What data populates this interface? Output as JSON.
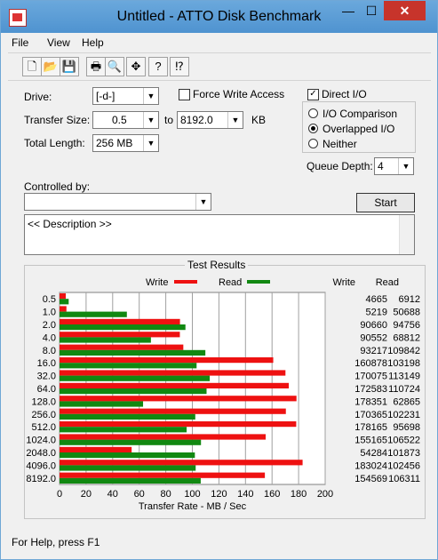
{
  "window": {
    "title": "Untitled - ATTO Disk Benchmark",
    "min": "—",
    "max": "☐",
    "close": "✕"
  },
  "menu": [
    "File",
    "View",
    "Help"
  ],
  "toolbar": [
    "new-icon",
    "open-icon",
    "save-icon",
    "print-icon",
    "print-preview-icon",
    "move-icon",
    "help-icon",
    "context-help-icon"
  ],
  "form": {
    "drive_label": "Drive:",
    "drive_value": "[-d-]",
    "force_write_label": "Force Write Access",
    "force_write_checked": false,
    "direct_io_label": "Direct I/O",
    "direct_io_checked": true,
    "transfer_size_label": "Transfer Size:",
    "transfer_from": "0.5",
    "to_label": "to",
    "transfer_to": "8192.0",
    "kb_label": "KB",
    "total_length_label": "Total Length:",
    "total_length_value": "256 MB",
    "io_comparison_label": "I/O Comparison",
    "overlapped_io_label": "Overlapped I/O",
    "neither_label": "Neither",
    "selected_io_mode": "Overlapped I/O",
    "queue_depth_label": "Queue Depth:",
    "queue_depth_value": "4",
    "controlled_by_label": "Controlled by:",
    "controlled_by_value": "",
    "start_label": "Start",
    "description": "<< Description >>"
  },
  "results": {
    "title": "Test Results",
    "write_legend": "Write",
    "read_legend": "Read",
    "write_col": "Write",
    "read_col": "Read",
    "rows": [
      {
        "size": "0.5",
        "write": "4665",
        "read": "6912"
      },
      {
        "size": "1.0",
        "write": "5219",
        "read": "50688"
      },
      {
        "size": "2.0",
        "write": "90660",
        "read": "94756"
      },
      {
        "size": "4.0",
        "write": "90552",
        "read": "68812"
      },
      {
        "size": "8.0",
        "write": "93217",
        "read": "109842"
      },
      {
        "size": "16.0",
        "write": "160878",
        "read": "103198"
      },
      {
        "size": "32.0",
        "write": "170075",
        "read": "113149"
      },
      {
        "size": "64.0",
        "write": "172583",
        "read": "110724"
      },
      {
        "size": "128.0",
        "write": "178351",
        "read": "62865"
      },
      {
        "size": "256.0",
        "write": "170365",
        "read": "102231"
      },
      {
        "size": "512.0",
        "write": "178165",
        "read": "95698"
      },
      {
        "size": "1024.0",
        "write": "155165",
        "read": "106522"
      },
      {
        "size": "2048.0",
        "write": "54284",
        "read": "101873"
      },
      {
        "size": "4096.0",
        "write": "183024",
        "read": "102456"
      },
      {
        "size": "8192.0",
        "write": "154569",
        "read": "106311"
      }
    ]
  },
  "chart_data": {
    "type": "bar",
    "xlabel": "Transfer Rate - MB / Sec",
    "xlim": [
      0,
      200
    ],
    "xticks": [
      "0",
      "20",
      "40",
      "60",
      "80",
      "100",
      "120",
      "140",
      "160",
      "180",
      "200"
    ],
    "categories": [
      "0.5",
      "1.0",
      "2.0",
      "4.0",
      "8.0",
      "16.0",
      "32.0",
      "64.0",
      "128.0",
      "256.0",
      "512.0",
      "1024.0",
      "2048.0",
      "4096.0",
      "8192.0"
    ],
    "series": [
      {
        "name": "Write",
        "color": "#ee1111",
        "values": [
          4.7,
          5.2,
          90.7,
          90.6,
          93.2,
          160.9,
          170.1,
          172.6,
          178.4,
          170.4,
          178.2,
          155.2,
          54.3,
          183.0,
          154.6
        ]
      },
      {
        "name": "Read",
        "color": "#118811",
        "values": [
          6.9,
          50.7,
          94.8,
          68.8,
          109.8,
          103.2,
          113.1,
          110.7,
          62.9,
          102.2,
          95.7,
          106.5,
          101.9,
          102.5,
          106.3
        ]
      }
    ],
    "grid": true
  },
  "status": "For Help, press F1"
}
